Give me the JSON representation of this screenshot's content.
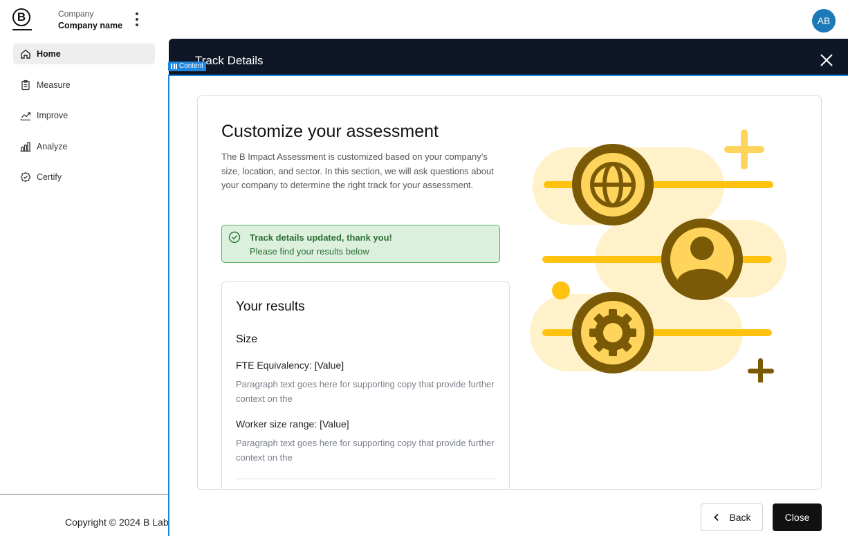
{
  "sidebar": {
    "company_kicker": "Company",
    "company_name": "Company name",
    "brand_letter": "B",
    "nav": [
      {
        "label": "Home",
        "icon": "home-icon",
        "active": true
      },
      {
        "label": "Measure",
        "icon": "clipboard-icon",
        "active": false
      },
      {
        "label": "Improve",
        "icon": "trend-up-icon",
        "active": false
      },
      {
        "label": "Analyze",
        "icon": "bar-chart-icon",
        "active": false
      },
      {
        "label": "Certify",
        "icon": "badge-check-icon",
        "active": false
      }
    ],
    "copyright": "Copyright © 2024 B Lab"
  },
  "header": {
    "avatar_initials": "AB",
    "avatar_color": "#1c7ab8"
  },
  "panel": {
    "title": "Track Details",
    "content_tag": "Content",
    "card": {
      "title": "Customize your assessment",
      "description": "The B Impact Assessment is customized based on your company’s size, location, and sector. In this section, we will ask questions about your company to determine the right track for your assessment.",
      "alert": {
        "title": "Track details updated, thank you!",
        "text": "Please find your results below"
      },
      "results": {
        "title": "Your results",
        "size_heading": "Size",
        "fields": [
          {
            "label": "FTE Equivalency: [Value]",
            "text": "Paragraph text goes here for supporting copy that provide further context on the"
          },
          {
            "label": "Worker size range: [Value]",
            "text": "Paragraph text goes here for supporting copy that provide further context on the"
          }
        ]
      }
    },
    "buttons": {
      "back": "Back",
      "close": "Close"
    }
  },
  "colors": {
    "header_bg": "#0f1726",
    "accent_blue": "#1f86e0",
    "success_bg": "#dbf0dd",
    "success_border": "#58b263",
    "illustration_yellow": "#ffc20e",
    "illustration_brown": "#7a5a07",
    "illustration_cream": "#fff1c9"
  }
}
